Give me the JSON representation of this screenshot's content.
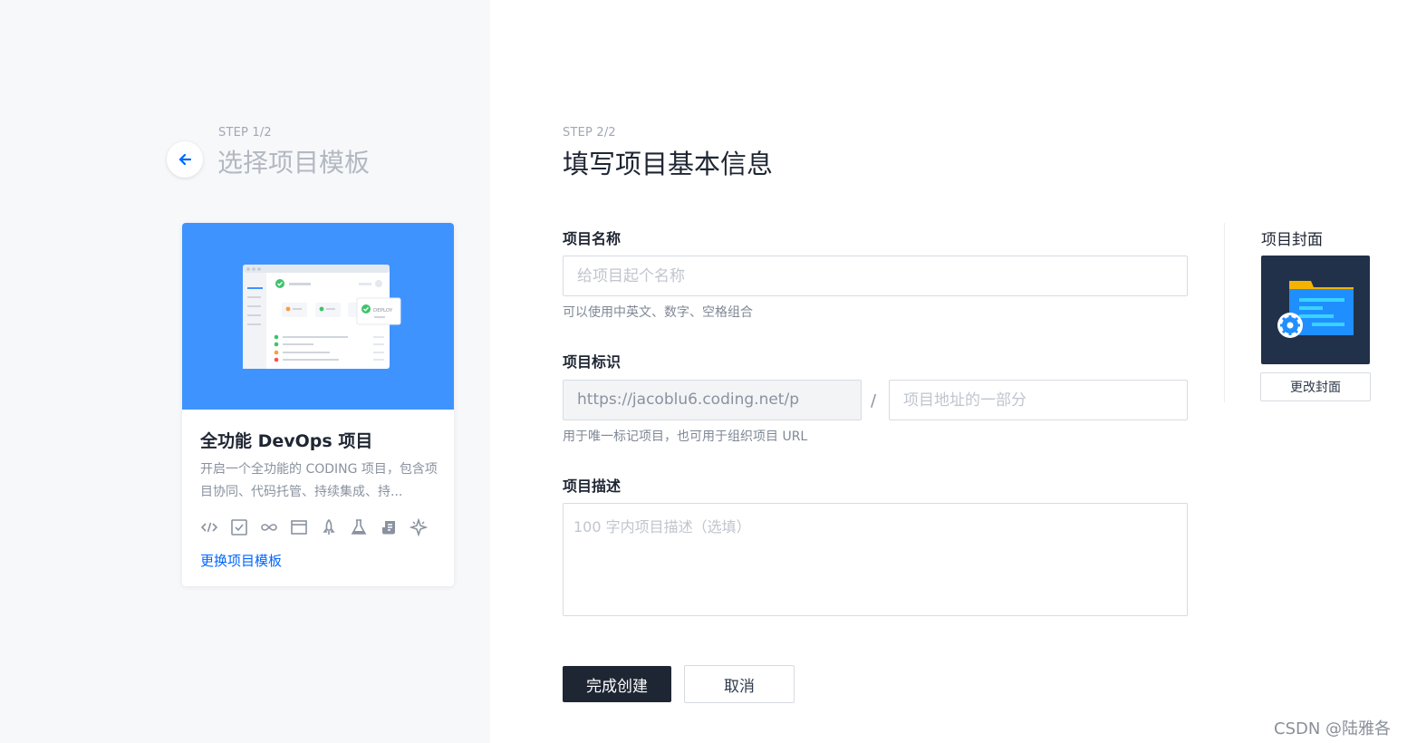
{
  "left": {
    "step": "STEP 1/2",
    "title": "选择项目模板",
    "template": {
      "title": "全功能 DevOps 项目",
      "description": "开启一个全功能的 CODING 项目，包含项目协同、代码托管、持续集成、持...",
      "deploy_badge": "DEPLOY",
      "feature_icons": [
        "code-icon",
        "checkbox-icon",
        "infinity-icon",
        "window-icon",
        "rocket-icon",
        "flask-icon",
        "docs-icon",
        "sparkle-icon"
      ],
      "change_link": "更换项目模板"
    }
  },
  "right": {
    "step": "STEP 2/2",
    "title": "填写项目基本信息",
    "name": {
      "label": "项目名称",
      "placeholder": "给项目起个名称",
      "hint": "可以使用中英文、数字、空格组合"
    },
    "identifier": {
      "label": "项目标识",
      "prefix": "https://jacoblu6.coding.net/p",
      "separator": "/",
      "placeholder": "项目地址的一部分",
      "hint": "用于唯一标记项目，也可用于组织项目 URL"
    },
    "description": {
      "label": "项目描述",
      "placeholder": "100 字内项目描述（选填）"
    },
    "buttons": {
      "submit": "完成创建",
      "cancel": "取消"
    },
    "cover": {
      "label": "项目封面",
      "change_button": "更改封面"
    }
  },
  "watermark": "CSDN @陆雅各",
  "colors": {
    "accent": "#0066ff",
    "hero": "#3f93ff",
    "primary_button": "#1f2633",
    "cover_bg": "#22314a"
  }
}
